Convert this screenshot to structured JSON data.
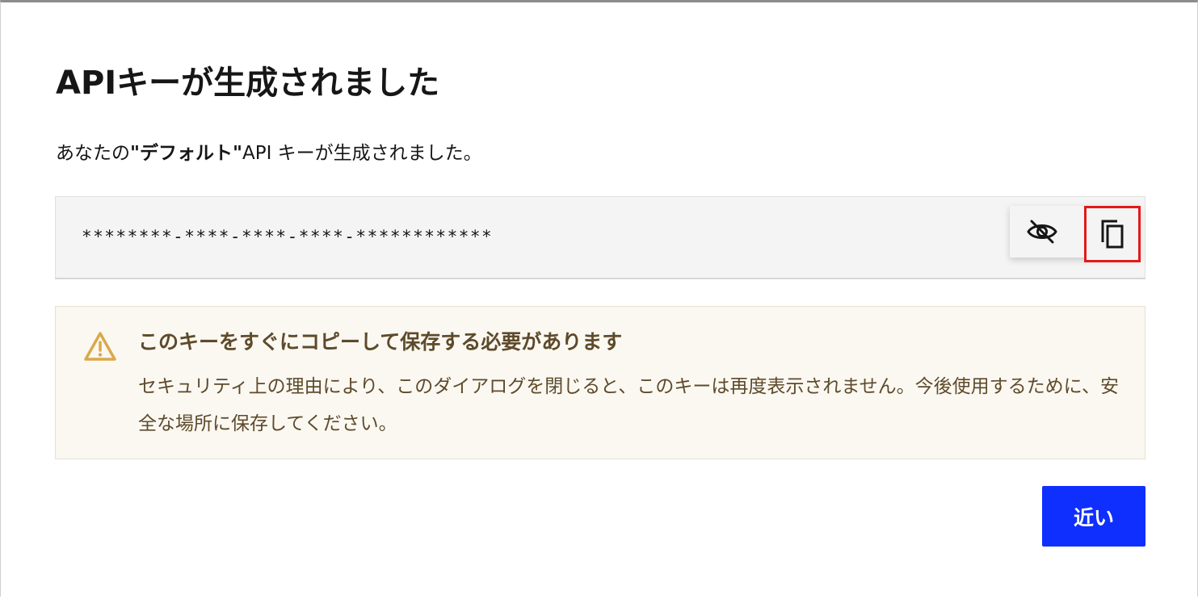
{
  "dialog": {
    "title": "APIキーが生成されました",
    "description_prefix": "あなたの",
    "description_key_name": "\"デフォルト\"",
    "description_suffix": "API キーが生成されました。"
  },
  "api_key": {
    "masked_value": "********-****-****-****-************",
    "toggle_visibility_icon": "eye-off-icon",
    "copy_icon": "copy-icon"
  },
  "warning": {
    "icon": "warning-triangle-icon",
    "title": "このキーをすぐにコピーして保存する必要があります",
    "body": "セキュリティ上の理由により、このダイアログを閉じると、このキーは再度表示されません。今後使用するために、安全な場所に保存してください。"
  },
  "actions": {
    "close_label": "近い"
  },
  "colors": {
    "primary_button": "#0f2fff",
    "warning_text": "#5e4a2a",
    "warning_icon": "#d9a94a",
    "highlight_border": "#e21a1a"
  }
}
